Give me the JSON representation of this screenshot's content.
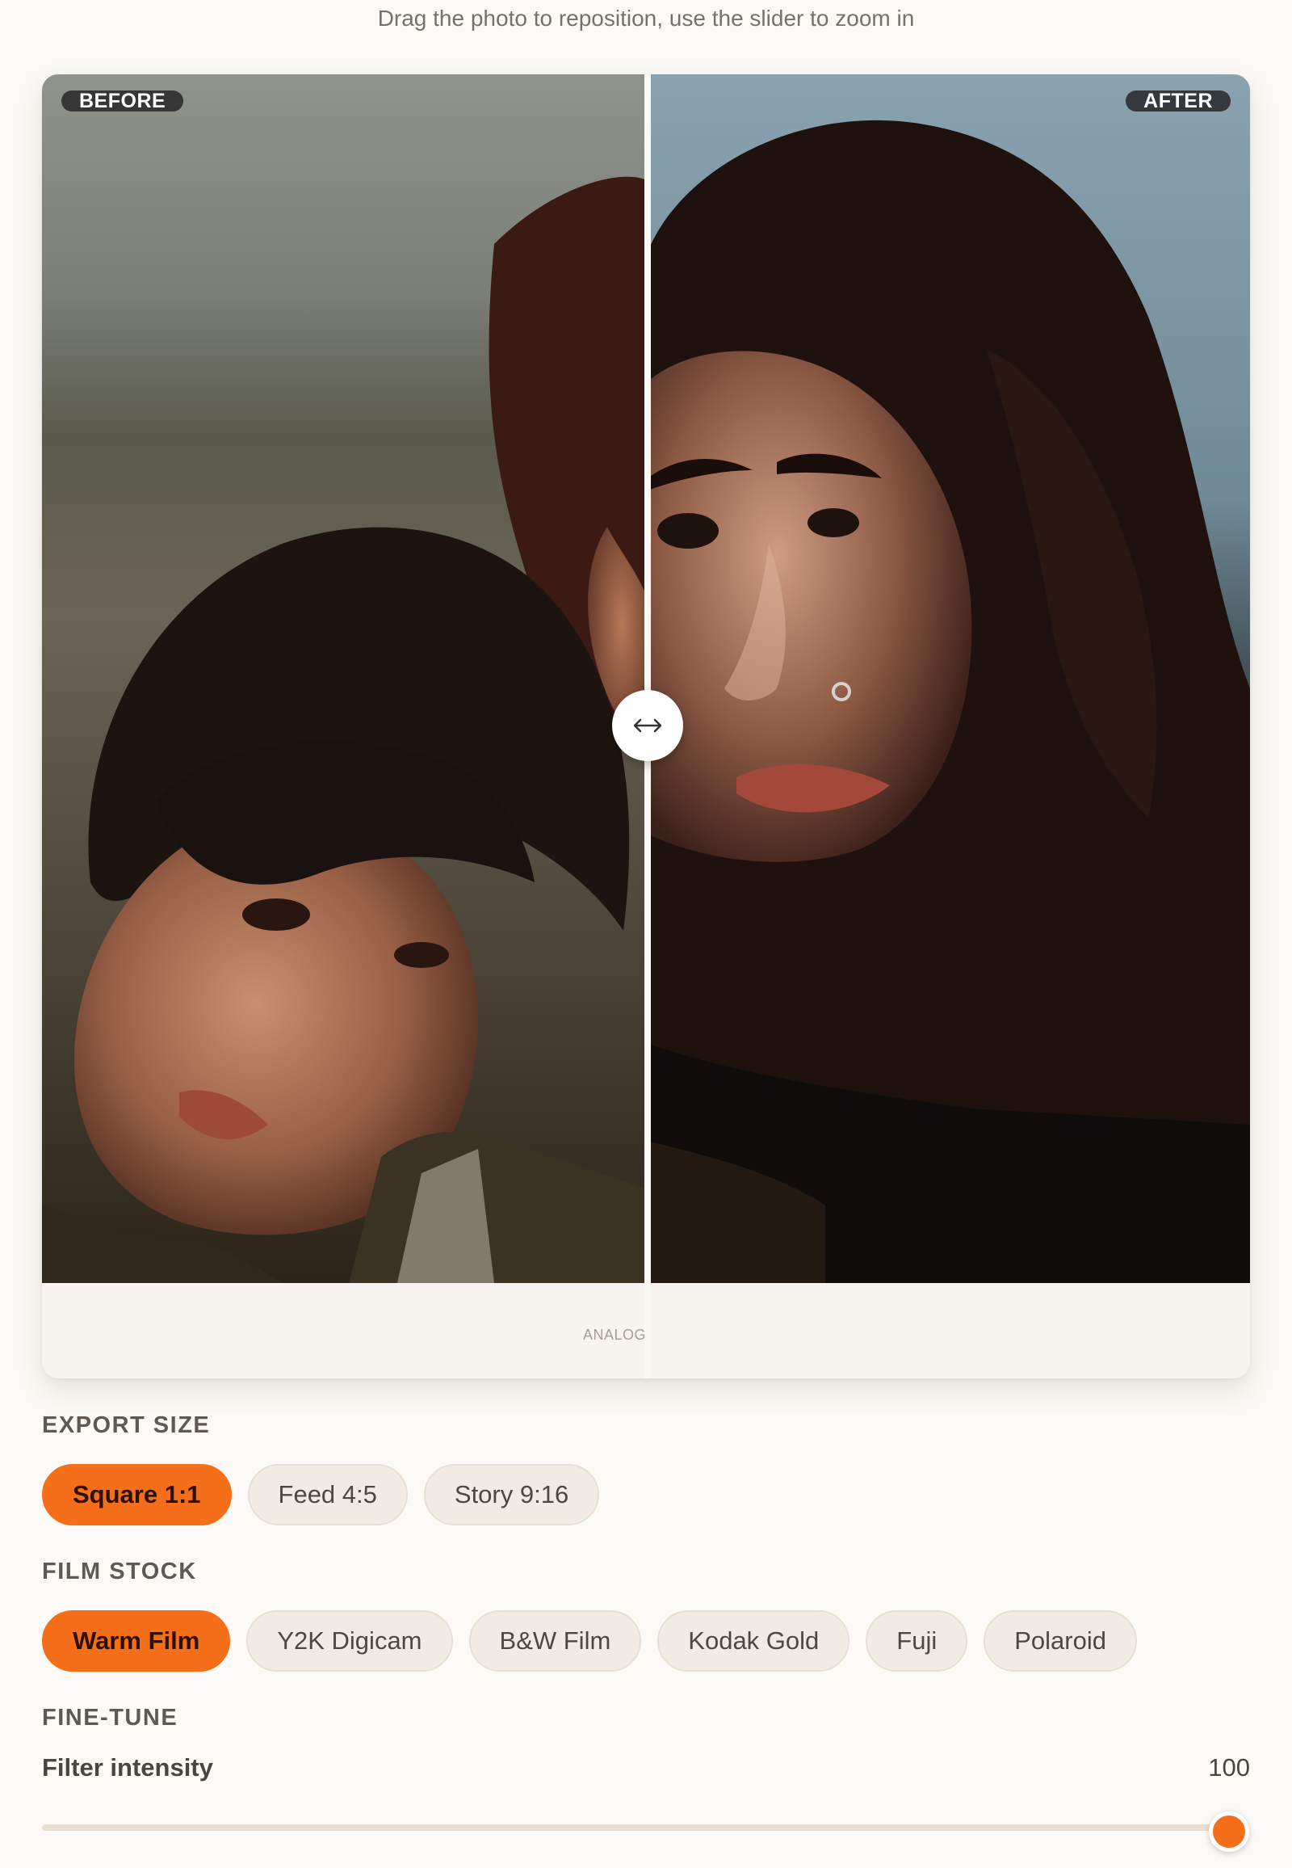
{
  "hint": "Drag the photo to reposition, use the slider to zoom in",
  "compare": {
    "before_label": "BEFORE",
    "after_label": "AFTER",
    "watermark": "ANALOG",
    "handle_icon": "left-right-arrows-icon"
  },
  "export_size": {
    "label": "EXPORT SIZE",
    "options": [
      "Square 1:1",
      "Feed 4:5",
      "Story 9:16"
    ],
    "selected": "Square 1:1"
  },
  "film_stock": {
    "label": "FILM STOCK",
    "options": [
      "Warm Film",
      "Y2K Digicam",
      "B&W Film",
      "Kodak Gold",
      "Fuji",
      "Polaroid"
    ],
    "selected": "Warm Film"
  },
  "fine_tune": {
    "label": "FINE-TUNE",
    "intensity_label": "Filter intensity",
    "intensity_value": "100",
    "intensity_fraction": 1.0
  },
  "colors": {
    "accent": "#f56e1a",
    "chip_bg": "#f1ece3",
    "page_bg": "#fcfaf6"
  }
}
